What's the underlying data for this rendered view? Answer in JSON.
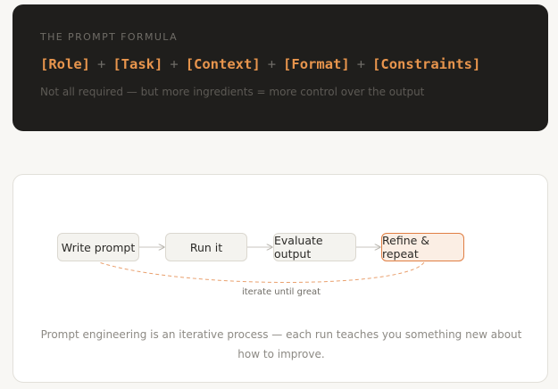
{
  "formula_card": {
    "eyebrow": "THE PROMPT FORMULA",
    "parts": [
      "[Role]",
      "[Task]",
      "[Context]",
      "[Format]",
      "[Constraints]"
    ],
    "separator": "+",
    "note": "Not all required — but more ingredients = more control over the output",
    "colors": {
      "background": "#1f1e1c",
      "accent": "#e8954d"
    }
  },
  "flow": {
    "steps": [
      "Write prompt",
      "Run it",
      "Evaluate output",
      "Refine & repeat"
    ],
    "loop_label": "iterate until great",
    "caption": "Prompt engineering is an iterative process — each run teaches you something new about how to improve.",
    "colors": {
      "accent": "#e07f44",
      "node_fill": "#f4f3ef"
    }
  }
}
